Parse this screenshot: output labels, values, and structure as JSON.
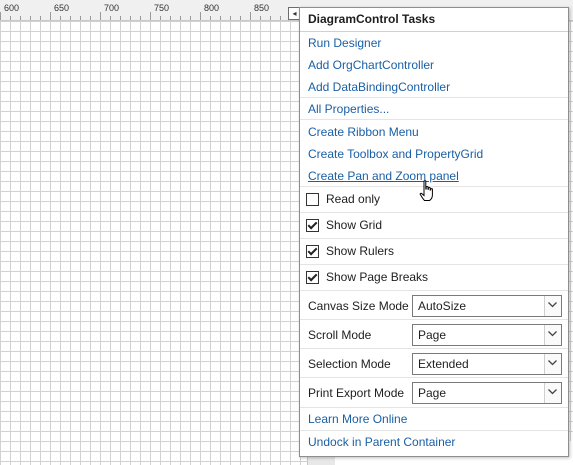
{
  "ruler": {
    "labels": [
      "600",
      "650",
      "700",
      "750",
      "800",
      "850"
    ]
  },
  "panel": {
    "title": "DiagramControl Tasks",
    "links_top": [
      "Run Designer",
      "Add OrgChartController",
      "Add DataBindingController"
    ],
    "all_properties": "All Properties...",
    "links_mid": [
      "Create Ribbon Menu",
      "Create Toolbox and PropertyGrid",
      "Create Pan and Zoom panel"
    ],
    "checks": [
      {
        "label": "Read only",
        "checked": false
      },
      {
        "label": "Show Grid",
        "checked": true
      },
      {
        "label": "Show Rulers",
        "checked": true
      },
      {
        "label": "Show Page Breaks",
        "checked": true
      }
    ],
    "props": [
      {
        "label": "Canvas Size Mode",
        "value": "AutoSize"
      },
      {
        "label": "Scroll Mode",
        "value": "Page"
      },
      {
        "label": "Selection Mode",
        "value": "Extended"
      },
      {
        "label": "Print Export Mode",
        "value": "Page"
      }
    ],
    "learn_more": "Learn More Online",
    "undock": "Undock in Parent Container"
  },
  "colors": {
    "link": "#1a5fa6",
    "grid": "#d2d2d2",
    "ruler_bg": "#f0f0f0"
  },
  "icons": {
    "collapse": "collapse-arrow-icon",
    "cursor": "hand-pointer-icon",
    "dropdown": "chevron-down-icon"
  }
}
